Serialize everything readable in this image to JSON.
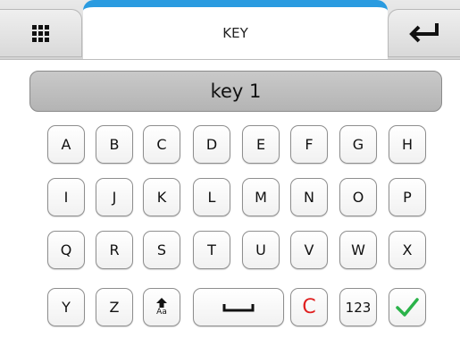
{
  "header": {
    "title": "KEY",
    "menu_icon": "grid-menu-icon",
    "enter_icon": "enter-return-icon",
    "accent_color": "#2a9be0"
  },
  "input": {
    "value": "key 1"
  },
  "keyboard": {
    "rows": [
      [
        "A",
        "B",
        "C",
        "D",
        "E",
        "F",
        "G",
        "H"
      ],
      [
        "I",
        "J",
        "K",
        "L",
        "M",
        "N",
        "O",
        "P"
      ],
      [
        "Q",
        "R",
        "S",
        "T",
        "U",
        "V",
        "W",
        "X"
      ]
    ],
    "bottom": {
      "y": "Y",
      "z": "Z",
      "shift_label": "Aa",
      "shift_icon": "shift-arrow-icon",
      "space_icon": "space-bar-icon",
      "clear": "C",
      "numeric": "123",
      "confirm_icon": "checkmark-icon",
      "clear_color": "#e02020",
      "confirm_color": "#2bb34a"
    }
  }
}
